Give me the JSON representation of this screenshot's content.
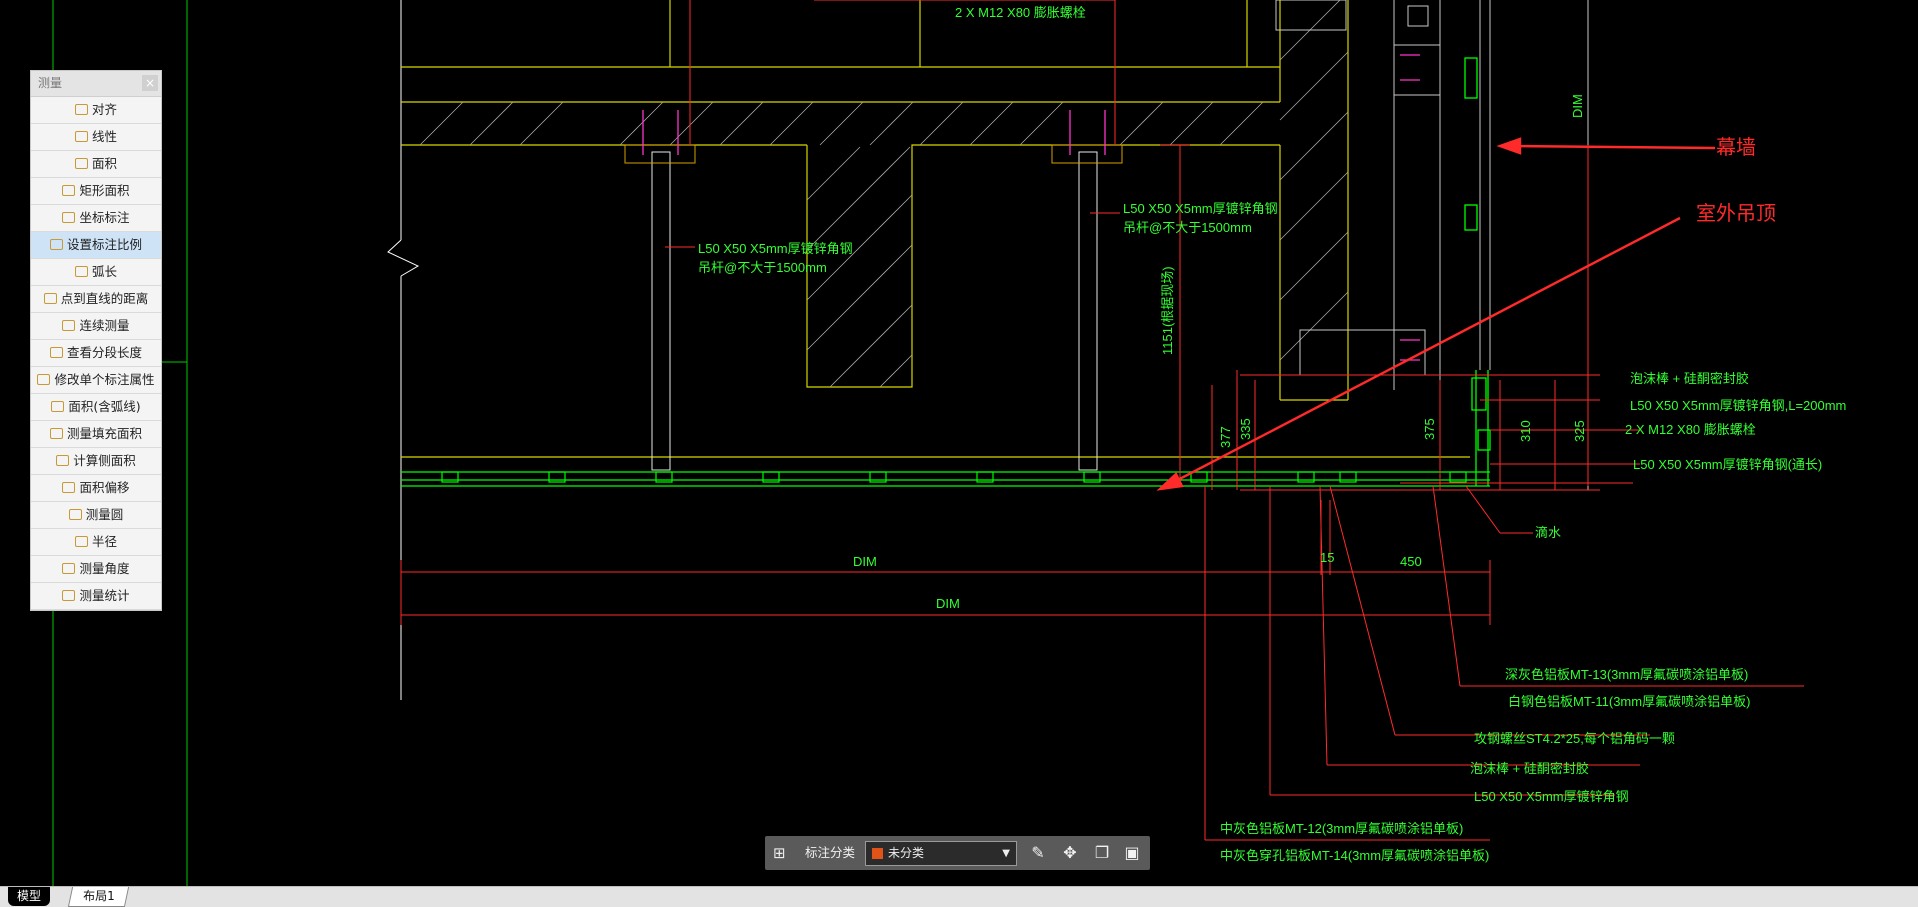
{
  "drawing": {
    "top_label": "2 X M12 X80 膨胀螺栓",
    "hanger_left_line1": "L50 X50 X5mm厚镀锌角钢",
    "hanger_left_line2": "吊杆@不大于1500mm",
    "hanger_right_line1": "L50 X50 X5mm厚镀锌角钢",
    "hanger_right_line2": "吊杆@不大于1500mm",
    "vertical_dim_text": "1151(根据现场)",
    "dim_top_right": "DIM",
    "callout_curtain_wall": "幕墙",
    "callout_outdoor_ceiling": "室外吊顶",
    "label_foam_sealant_top": "泡沫棒 + 硅酮密封胶",
    "label_angle_200": "L50 X50 X5mm厚镀锌角钢,L=200mm",
    "label_bolts": "2 X M12 X80 膨胀螺栓",
    "label_angle_continuous": "L50 X50 X5mm厚镀锌角钢(通长)",
    "label_drip": "滴水",
    "dim_377": "377",
    "dim_335": "335",
    "dim_375": "375",
    "dim_310": "310",
    "dim_325": "325",
    "dim_bottom_1": "DIM",
    "dim_bottom_2": "DIM",
    "dim_15": "15",
    "dim_450": "450",
    "label_mt13": "深灰色铝板MT-13(3mm厚氟碳喷涂铝单板)",
    "label_mt11": "白钢色铝板MT-11(3mm厚氟碳喷涂铝单板)",
    "label_screw": "攻钢螺丝ST4.2*25,每个铝角码一颗",
    "label_foam_sealant_bottom": "泡沫棒 + 硅酮密封胶",
    "label_angle_bottom": "L50 X50 X5mm厚镀锌角钢",
    "label_mt12": "中灰色铝板MT-12(3mm厚氟碳喷涂铝单板)",
    "label_mt14": "中灰色穿孔铝板MT-14(3mm厚氟碳喷涂铝单板)"
  },
  "measure_panel": {
    "title": "测量",
    "close_glyph": "×",
    "items": [
      {
        "label": "对齐",
        "icon": "align-measure-icon"
      },
      {
        "label": "线性",
        "icon": "linear-measure-icon"
      },
      {
        "label": "面积",
        "icon": "area-icon"
      },
      {
        "label": "矩形面积",
        "icon": "rect-area-icon"
      },
      {
        "label": "坐标标注",
        "icon": "coordinate-icon"
      },
      {
        "label": "设置标注比例",
        "icon": "scale-icon"
      },
      {
        "label": "弧长",
        "icon": "arc-length-icon"
      },
      {
        "label": "点到直线的距离",
        "icon": "point-line-distance-icon"
      },
      {
        "label": "连续测量",
        "icon": "continuous-measure-icon"
      },
      {
        "label": "查看分段长度",
        "icon": "segment-length-icon"
      },
      {
        "label": "修改单个标注属性",
        "icon": "edit-annotation-icon"
      },
      {
        "label": "面积(含弧线)",
        "icon": "arc-area-icon"
      },
      {
        "label": "测量填充面积",
        "icon": "hatch-area-icon"
      },
      {
        "label": "计算侧面积",
        "icon": "side-area-icon"
      },
      {
        "label": "面积偏移",
        "icon": "area-offset-icon"
      },
      {
        "label": "测量圆",
        "icon": "circle-measure-icon"
      },
      {
        "label": "半径",
        "icon": "radius-icon"
      },
      {
        "label": "测量角度",
        "icon": "angle-icon"
      },
      {
        "label": "测量统计",
        "icon": "statistics-icon"
      }
    ],
    "active_item": "设置标注比例"
  },
  "annotation_toolbar": {
    "label": "标注分类",
    "selected_category": "未分类",
    "category_color": "#e0541a"
  },
  "tabs": {
    "model": "模型",
    "layout": "布局1"
  },
  "colors": {
    "dim_red": "#ff2a2a",
    "steel_green": "#00ff00",
    "concrete_yellow": "#d6d600",
    "text_green": "#33ff33"
  }
}
